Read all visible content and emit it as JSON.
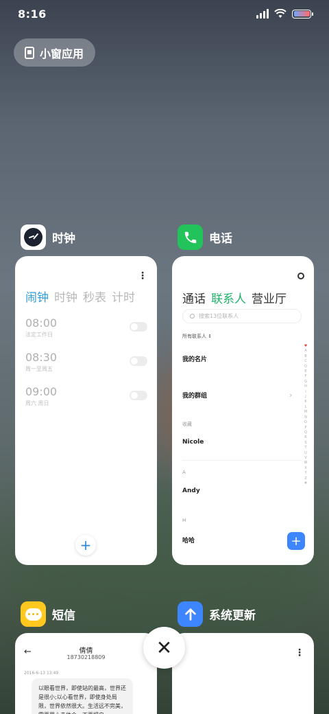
{
  "status_bar": {
    "time": "8:16"
  },
  "small_window": {
    "label": "小窗应用"
  },
  "apps": {
    "clock": {
      "name": "时钟",
      "tabs": [
        "闹钟",
        "时钟",
        "秒表",
        "计时"
      ],
      "active_tab": "闹钟",
      "alarms": [
        {
          "time": "08:00",
          "desc": "法定工作日",
          "enabled": false
        },
        {
          "time": "08:30",
          "desc": "周一至周五",
          "enabled": false
        },
        {
          "time": "09:00",
          "desc": "周六 周日",
          "enabled": false
        }
      ],
      "add_label": "+"
    },
    "phone": {
      "name": "电话",
      "tabs": [
        "通话",
        "联系人",
        "营业厅"
      ],
      "active_tab": "联系人",
      "search_placeholder": "搜索13位联系人",
      "filter_label": "所有联系人",
      "my_card": "我的名片",
      "my_groups": "我的群组",
      "favorites_header": "收藏",
      "favorite_contact": "Nicole",
      "section_a": "A",
      "contact_a": "Andy",
      "section_h": "H",
      "contact_h": "哈哈",
      "index_letters": [
        "♥",
        "A",
        "B",
        "C",
        "D",
        "E",
        "F",
        "G",
        "H",
        "I",
        "J",
        "K",
        "L",
        "M",
        "N",
        "O",
        "P",
        "Q",
        "R",
        "S",
        "T",
        "U",
        "V",
        "W",
        "X",
        "Y",
        "Z",
        "#"
      ],
      "add_label": "+"
    },
    "sms": {
      "name": "短信",
      "contact_name": "倩倩",
      "contact_number": "18730218809",
      "date": "2016-6-13 13:49",
      "message": "以眼看世界，即使站的最高，世界还是很小;以心看世界，即使身处局限，世界依然很大。生活远不完美，需要用心去体会，不要把自..."
    },
    "update": {
      "name": "系统更新"
    }
  },
  "close_label": "✕",
  "colors": {
    "clock_accent": "#2f9cd8",
    "phone_accent": "#21b36a",
    "fab_blue": "#3d86ff",
    "sms_yellow": "#ffc81e"
  }
}
